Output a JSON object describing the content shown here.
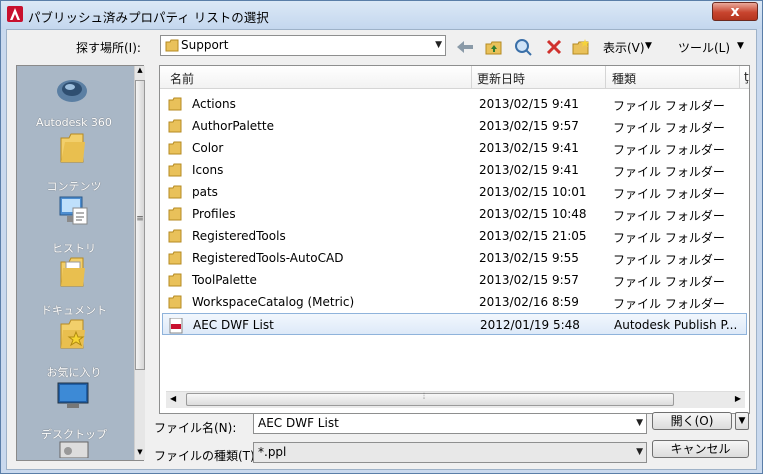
{
  "window": {
    "title": "パブリッシュ済みプロパティ リストの選択",
    "close_glyph": "x"
  },
  "lookin": {
    "label": "探す場所(I):",
    "value": "Support"
  },
  "toolbar": {
    "views_label": "表示(V)",
    "tools_label": "ツール(L)"
  },
  "places": [
    {
      "label": "Autodesk 360",
      "icon": "cloud-icon"
    },
    {
      "label": "コンテンツ",
      "icon": "folder-icon"
    },
    {
      "label": "ヒストリ",
      "icon": "history-icon"
    },
    {
      "label": "ドキュメント",
      "icon": "documents-icon"
    },
    {
      "label": "お気に入り",
      "icon": "favorites-icon"
    },
    {
      "label": "デスクトップ",
      "icon": "desktop-icon"
    }
  ],
  "columns": {
    "name": "名前",
    "date": "更新日時",
    "type": "種類",
    "extra": "ţ"
  },
  "files": [
    {
      "name": "Actions",
      "date": "2013/02/15 9:41",
      "type": "ファイル フォルダー",
      "kind": "folder"
    },
    {
      "name": "AuthorPalette",
      "date": "2013/02/15 9:57",
      "type": "ファイル フォルダー",
      "kind": "folder"
    },
    {
      "name": "Color",
      "date": "2013/02/15 9:41",
      "type": "ファイル フォルダー",
      "kind": "folder"
    },
    {
      "name": "Icons",
      "date": "2013/02/15 9:41",
      "type": "ファイル フォルダー",
      "kind": "folder"
    },
    {
      "name": "pats",
      "date": "2013/02/15 10:01",
      "type": "ファイル フォルダー",
      "kind": "folder"
    },
    {
      "name": "Profiles",
      "date": "2013/02/15 10:48",
      "type": "ファイル フォルダー",
      "kind": "folder"
    },
    {
      "name": "RegisteredTools",
      "date": "2013/02/15 21:05",
      "type": "ファイル フォルダー",
      "kind": "folder"
    },
    {
      "name": "RegisteredTools-AutoCAD",
      "date": "2013/02/15 9:55",
      "type": "ファイル フォルダー",
      "kind": "folder"
    },
    {
      "name": "ToolPalette",
      "date": "2013/02/15 9:57",
      "type": "ファイル フォルダー",
      "kind": "folder"
    },
    {
      "name": "WorkspaceCatalog (Metric)",
      "date": "2013/02/16 8:59",
      "type": "ファイル フォルダー",
      "kind": "folder"
    },
    {
      "name": "AEC DWF List",
      "date": "2012/01/19 5:48",
      "type": "Autodesk Publish P...",
      "kind": "file",
      "selected": true
    }
  ],
  "filename": {
    "label": "ファイル名(N):",
    "value": "AEC DWF List"
  },
  "filetype": {
    "label": "ファイルの種類(T):",
    "value": "*.ppl"
  },
  "buttons": {
    "open": "開く(O)",
    "cancel": "キャンセル"
  }
}
